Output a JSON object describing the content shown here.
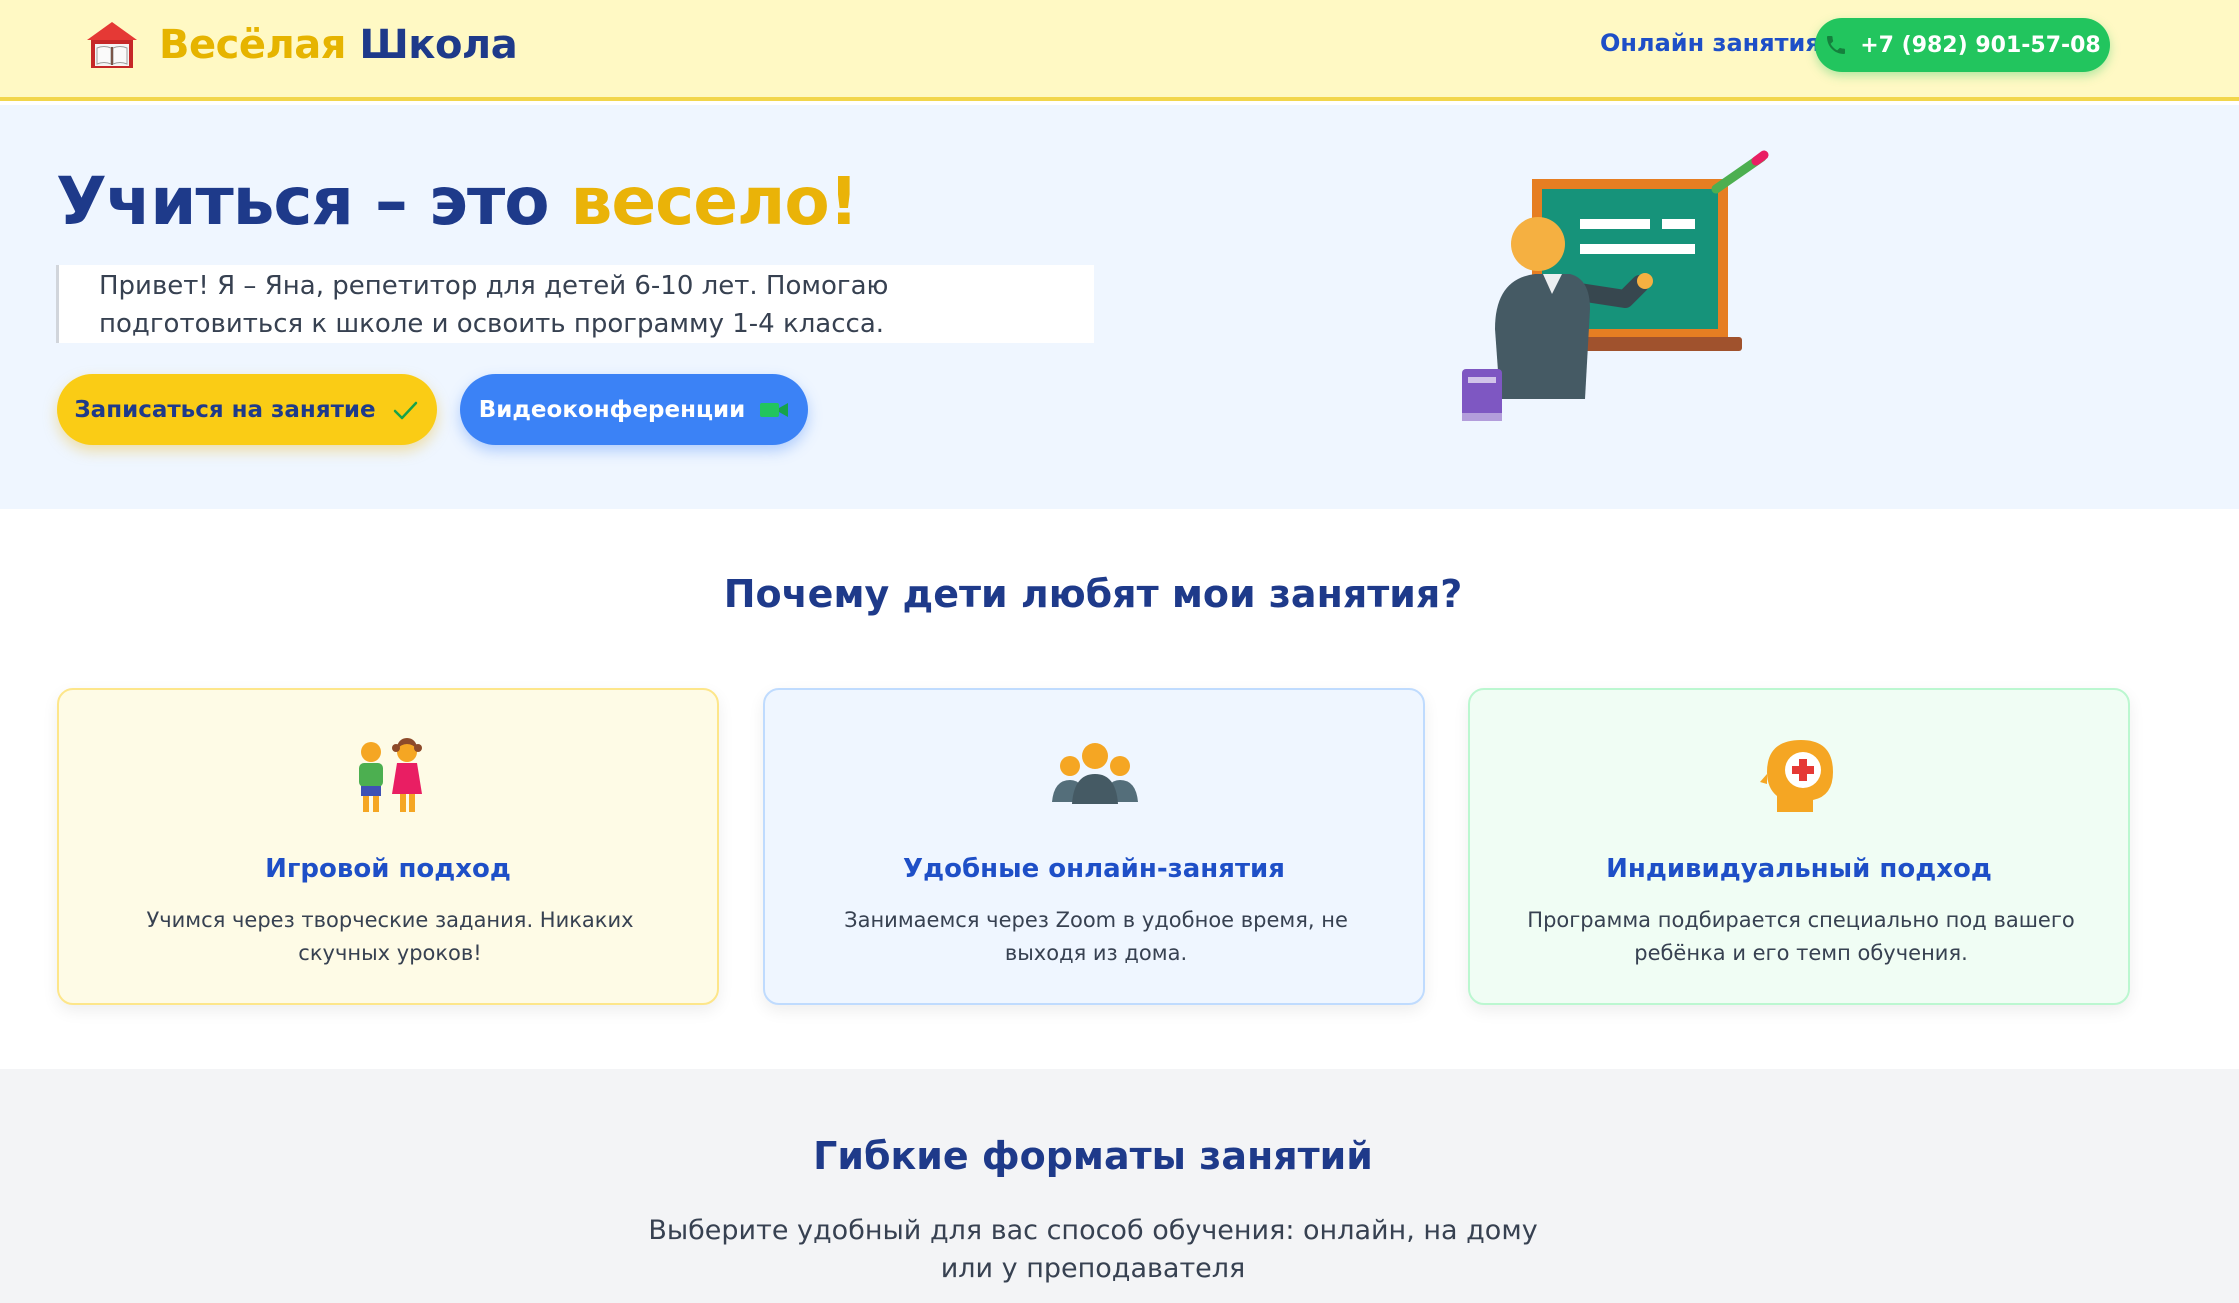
{
  "header": {
    "logo_part1": "Весёлая",
    "logo_part2": "Школа",
    "nav_link": "Онлайн занятия",
    "phone": "+7 (982) 901-57-08"
  },
  "hero": {
    "title_main": "Учиться – это ",
    "title_accent": "весело!",
    "description": "Привет! Я – Яна, репетитор для детей 6-10 лет. Помогаю подготовиться к школе и освоить программу 1-4 класса.",
    "primary_button": "Записаться на занятие",
    "secondary_button": "Видеоконференции"
  },
  "features": {
    "title": "Почему дети любят мои занятия?",
    "cards": [
      {
        "title": "Игровой подход",
        "text": "Учимся через творческие задания. Никаких скучных уроков!",
        "icon": "children-icon"
      },
      {
        "title": "Удобные онлайн-занятия",
        "text": "Занимаемся через Zoom в удобное время, не выходя из дома.",
        "icon": "group-icon"
      },
      {
        "title": "Индивидуальный подход",
        "text": "Программа подбирается специально под вашего ребёнка и его темп обучения.",
        "icon": "head-plus-icon"
      }
    ]
  },
  "formats": {
    "title": "Гибкие форматы занятий",
    "subtitle": "Выберите удобный для вас способ обучения: онлайн, на дому или у преподавателя"
  },
  "colors": {
    "header_bg": "#fff9c4",
    "brand_blue": "#1e3a8a",
    "accent_yellow": "#facc15",
    "button_blue": "#3b82f6",
    "phone_green": "#22c55e"
  }
}
